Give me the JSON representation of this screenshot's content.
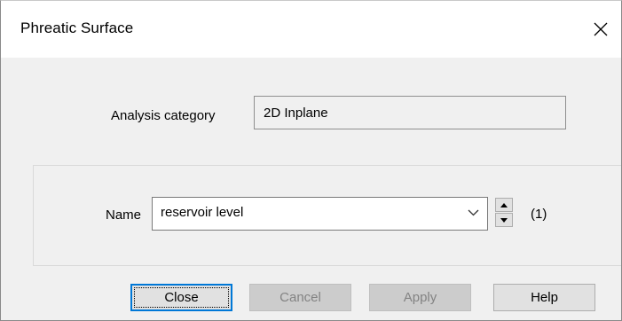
{
  "window": {
    "title": "Phreatic Surface",
    "close_icon": "close-icon"
  },
  "analysis": {
    "label": "Analysis category",
    "value": "2D Inplane"
  },
  "name_field": {
    "label": "Name",
    "value": "reservoir level",
    "count": "(1)"
  },
  "buttons": {
    "close": "Close",
    "cancel": "Cancel",
    "apply": "Apply",
    "help": "Help"
  },
  "colors": {
    "dialog_bg": "#f0f0f0",
    "focus_border": "#0078d7",
    "disabled_text": "#838383"
  }
}
